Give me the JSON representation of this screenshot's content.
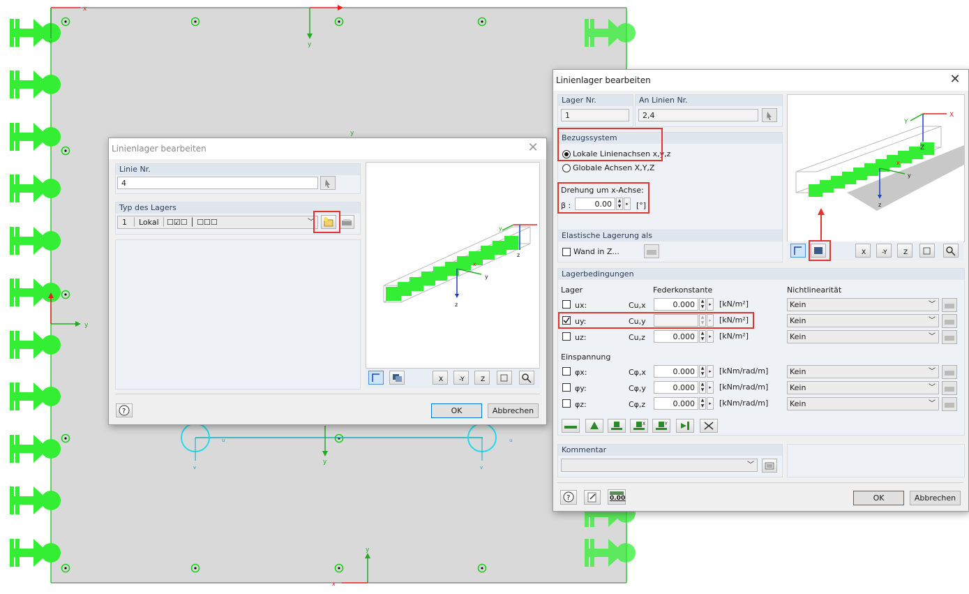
{
  "dialog_small": {
    "title": "Linienlager bearbeiten",
    "line_no_header": "Linie Nr.",
    "line_no_value": "4",
    "support_type_header": "Typ des Lagers",
    "support_type_no": "1",
    "support_type_name": "Lokal",
    "support_type_flags": "☐☑☐ │ ☐☐☐",
    "preview_labels": {
      "x": "x",
      "y": "y",
      "z": "z"
    },
    "ok_label": "OK",
    "cancel_label": "Abbrechen",
    "close_glyph": "✕"
  },
  "dialog_main": {
    "title": "Linienlager bearbeiten",
    "close_glyph": "✕",
    "support_no_header": "Lager Nr.",
    "support_no_value": "1",
    "lines_no_header": "An Linien Nr.",
    "lines_no_value": "2,4",
    "ref_system_header": "Bezugssystem",
    "ref_local_label": "Lokale Linienachsen x,y,z",
    "ref_global_label": "Globale Achsen X,Y,Z",
    "rotation_label": "Drehung um x-Achse:",
    "beta_label": "β :",
    "beta_value": "0.00",
    "beta_unit": "[°]",
    "elastic_header": "Elastische Lagerung als",
    "wall_label": "Wand in Z...",
    "conditions_header": "Lagerbedingungen",
    "col_support": "Lager",
    "col_spring": "Federkonstante",
    "col_nonlinear": "Nichtlinearität",
    "rows": [
      {
        "label": "ux:",
        "spring": "Cu,x",
        "value": "0.000",
        "unit": "[kN/m²]",
        "checked": false,
        "nonlinear": "Kein"
      },
      {
        "label": "uy:",
        "spring": "Cu,y",
        "value": "",
        "unit": "[kN/m²]",
        "checked": true,
        "nonlinear": "Kein"
      },
      {
        "label": "uz:",
        "spring": "Cu,z",
        "value": "0.000",
        "unit": "[kN/m²]",
        "checked": false,
        "nonlinear": "Kein"
      }
    ],
    "fixity_header": "Einspannung",
    "fix_rows": [
      {
        "label": "φx:",
        "spring": "Cφ,x",
        "value": "0.000",
        "unit": "[kNm/rad/m]",
        "checked": false,
        "nonlinear": "Kein"
      },
      {
        "label": "φy:",
        "spring": "Cφ,y",
        "value": "0.000",
        "unit": "[kNm/rad/m]",
        "checked": false,
        "nonlinear": "Kein"
      },
      {
        "label": "φz:",
        "spring": "Cφ,z",
        "value": "0.000",
        "unit": "[kNm/rad/m]",
        "checked": false,
        "nonlinear": "Kein"
      }
    ],
    "comment_header": "Kommentar",
    "comment_value": "",
    "preview_labels": {
      "X": "X",
      "Y": "Y",
      "Z": "Z",
      "x": "x",
      "y": "y",
      "z": "z"
    },
    "ok_label": "OK",
    "cancel_label": "Abbrechen",
    "zero_btn_label": "0.00"
  },
  "canvas": {
    "axis_labels": {
      "x": "x",
      "y": "y",
      "u": "u",
      "v": "v"
    },
    "colors": {
      "support_green": "#33ee33",
      "axis_red": "#e22020",
      "axis_blue": "#1a3fd0",
      "axis_green": "#22aa22",
      "highlight_red": "#e2332f"
    }
  }
}
